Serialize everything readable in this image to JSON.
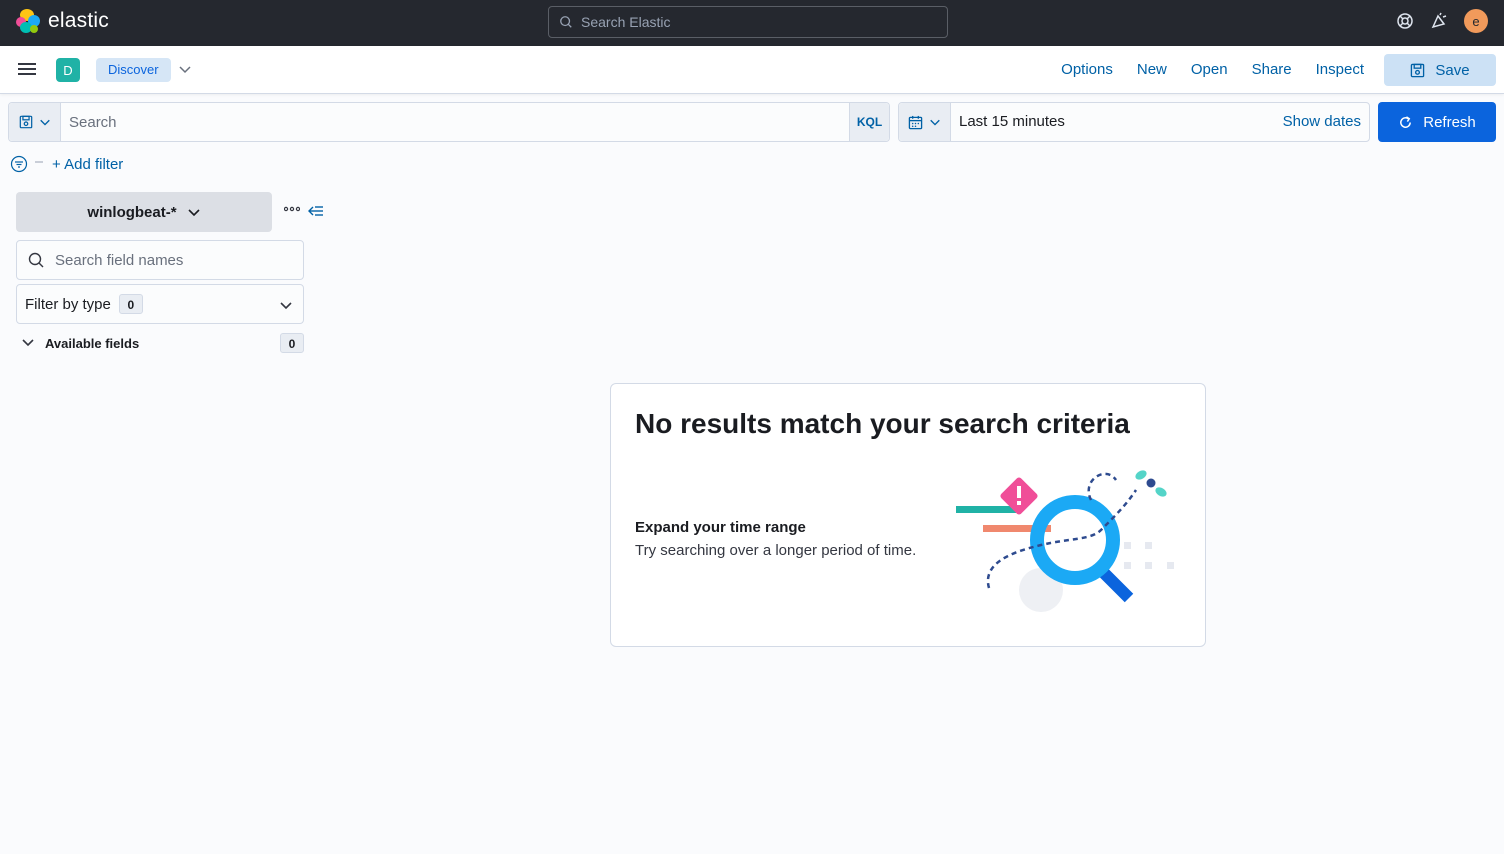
{
  "header": {
    "logo_text": "elastic",
    "search_placeholder": "Search Elastic",
    "avatar_initial": "e",
    "icons": [
      "help-icon",
      "newsfeed-icon"
    ]
  },
  "app_bar": {
    "space_initial": "D",
    "breadcrumb": "Discover",
    "menu": [
      "Options",
      "New",
      "Open",
      "Share",
      "Inspect"
    ],
    "save_label": "Save"
  },
  "query": {
    "placeholder": "Search",
    "language": "KQL"
  },
  "date_picker": {
    "value": "Last 15 minutes",
    "show_dates": "Show dates",
    "refresh_label": "Refresh"
  },
  "filters": {
    "add_filter": "+ Add filter"
  },
  "sidebar": {
    "index_pattern": "winlogbeat-*",
    "field_search_placeholder": "Search field names",
    "filter_by_type": "Filter by type",
    "filter_count": "0",
    "available_fields": "Available fields",
    "available_count": "0"
  },
  "empty_state": {
    "title": "No results match your search criteria",
    "subtitle": "Expand your time range",
    "description": "Try searching over a longer period of time."
  },
  "colors": {
    "header_bg": "#25282f",
    "primary": "#0b64dd",
    "link": "#0061a6",
    "space_badge": "#20b2a6",
    "avatar": "#f19a5b"
  }
}
